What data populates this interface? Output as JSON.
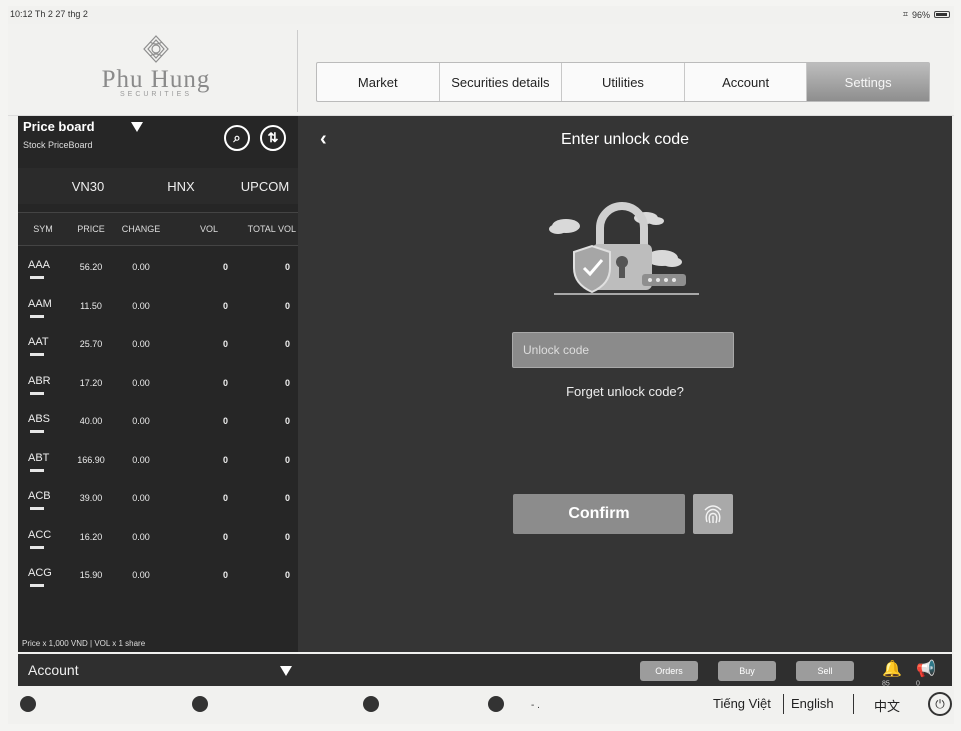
{
  "status_bar": {
    "time": "10:12  Th 2 27 thg 2",
    "battery": "96%"
  },
  "brand": {
    "name": "Phu Hung",
    "tagline": "SECURITIES"
  },
  "top_nav": [
    {
      "label": "Market",
      "active": false
    },
    {
      "label": "Securities details",
      "active": false
    },
    {
      "label": "Utilities",
      "active": false
    },
    {
      "label": "Account",
      "active": false
    },
    {
      "label": "Settings",
      "active": true
    }
  ],
  "price_board": {
    "title": "Price board",
    "subtitle": "Stock PriceBoard",
    "exchanges": [
      "VN30",
      "HNX",
      "UPCOM"
    ],
    "columns": [
      "SYM",
      "PRICE",
      "CHANGE",
      "VOL",
      "TOTAL VOL"
    ],
    "rows": [
      {
        "sym": "AAA",
        "price": "56.20",
        "change": "0.00",
        "vol": "0",
        "total": "0"
      },
      {
        "sym": "AAM",
        "price": "11.50",
        "change": "0.00",
        "vol": "0",
        "total": "0"
      },
      {
        "sym": "AAT",
        "price": "25.70",
        "change": "0.00",
        "vol": "0",
        "total": "0"
      },
      {
        "sym": "ABR",
        "price": "17.20",
        "change": "0.00",
        "vol": "0",
        "total": "0"
      },
      {
        "sym": "ABS",
        "price": "40.00",
        "change": "0.00",
        "vol": "0",
        "total": "0"
      },
      {
        "sym": "ABT",
        "price": "166.90",
        "change": "0.00",
        "vol": "0",
        "total": "0"
      },
      {
        "sym": "ACB",
        "price": "39.00",
        "change": "0.00",
        "vol": "0",
        "total": "0"
      },
      {
        "sym": "ACC",
        "price": "16.20",
        "change": "0.00",
        "vol": "0",
        "total": "0"
      },
      {
        "sym": "ACG",
        "price": "15.90",
        "change": "0.00",
        "vol": "0",
        "total": "0"
      }
    ],
    "footnote": "Price x 1,000 VND | VOL x 1 share"
  },
  "unlock": {
    "title": "Enter unlock code",
    "placeholder": "Unlock code",
    "forget_label": "Forget unlock code?",
    "confirm_label": "Confirm"
  },
  "account_bar": {
    "label": "Account",
    "orders": "Orders",
    "buy": "Buy",
    "sell": "Sell",
    "bell_count": "85",
    "announce_count": "0"
  },
  "languages": [
    "Tiếng Việt",
    "English",
    "中文"
  ],
  "bottom_dots": "- ."
}
